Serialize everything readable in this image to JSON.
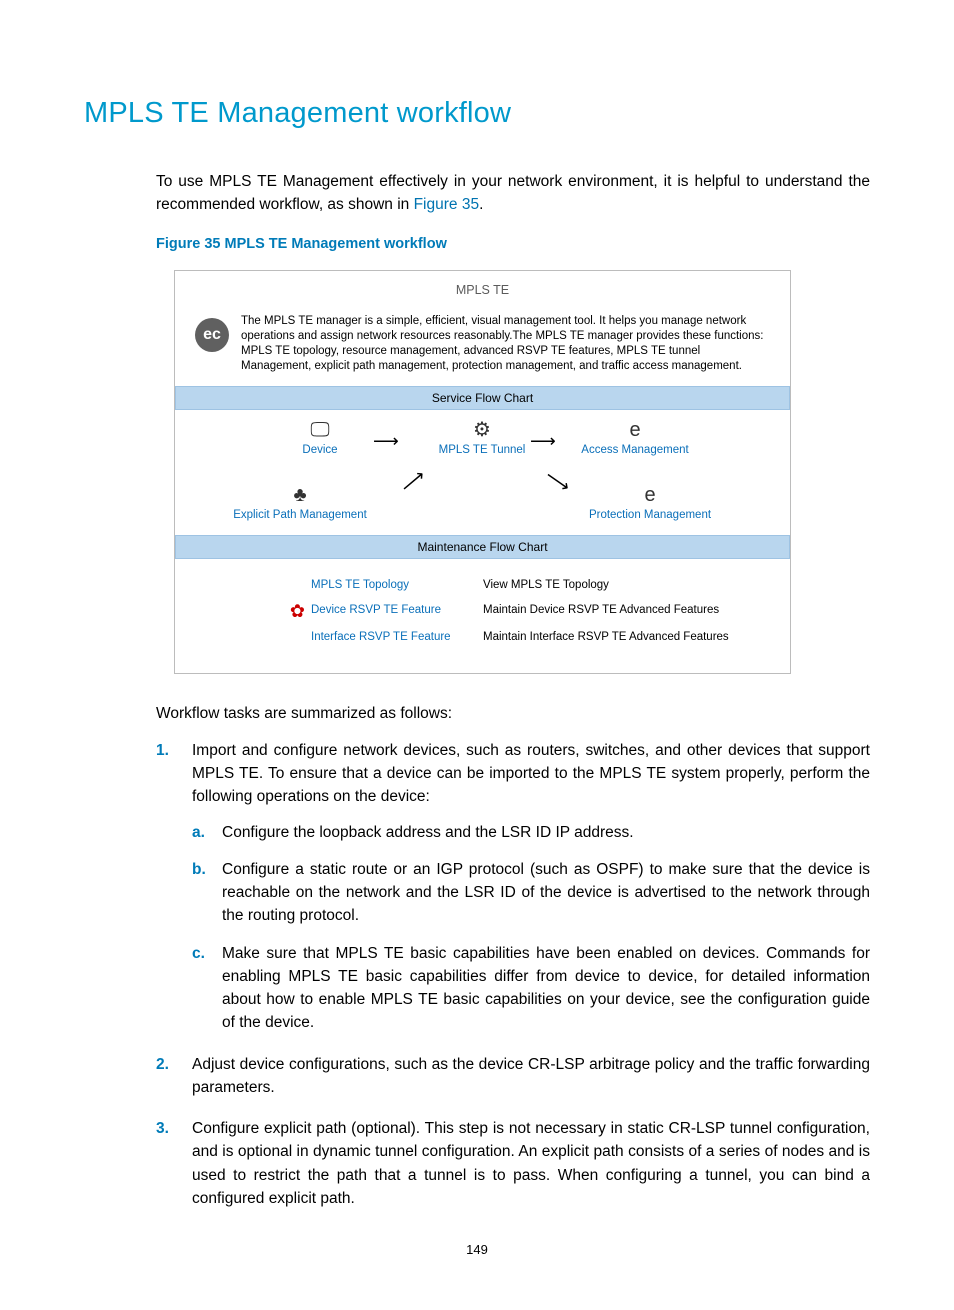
{
  "heading": "MPLS TE Management workflow",
  "intro_before_link": "To use MPLS TE Management effectively in your network environment, it is helpful to understand the recommended workflow, as shown in ",
  "intro_link": "Figure 35",
  "intro_after_link": ".",
  "figure_caption": "Figure 35 MPLS TE Management workflow",
  "figure": {
    "title": "MPLS TE",
    "ec_glyph": "ec",
    "description": "The MPLS TE manager is a simple, efficient, visual management tool. It helps you manage network operations and assign network resources reasonably.The MPLS TE manager provides these functions: MPLS TE topology, resource management, advanced RSVP TE features, MPLS TE tunnel Management, explicit path management, protection management, and traffic access management.",
    "service_bar": "Service Flow Chart",
    "nodes": {
      "device": "Device",
      "tunnel": "MPLS TE Tunnel",
      "access": "Access Management",
      "explicit": "Explicit Path Management",
      "protection": "Protection Management"
    },
    "maint_bar": "Maintenance Flow Chart",
    "maint_rows": [
      {
        "label": "MPLS TE Topology",
        "desc": "View MPLS TE Topology"
      },
      {
        "label": "Device RSVP TE Feature",
        "desc": "Maintain Device RSVP TE Advanced Features"
      },
      {
        "label": "Interface RSVP TE Feature",
        "desc": "Maintain Interface RSVP TE Advanced Features"
      }
    ],
    "icons": {
      "device_glyph": "🖵",
      "tunnel_glyph": "⚙",
      "access_glyph": "e",
      "explicit_glyph": "♣",
      "protection_glyph": "e",
      "gear_glyph": "✿"
    }
  },
  "after_figure": "Workflow tasks are summarized as follows:",
  "steps": [
    {
      "text": "Import and configure network devices, such as routers, switches, and other devices that support MPLS TE. To ensure that a device can be imported to the MPLS TE system properly, perform the following operations on the device:",
      "sub": [
        "Configure the loopback address and the LSR ID IP address.",
        "Configure a static route or an IGP protocol (such as OSPF) to make sure that the device is reachable on the network and the LSR ID of the device is advertised to the network through the routing protocol.",
        "Make sure that MPLS TE basic capabilities have been enabled on devices. Commands for enabling MPLS TE basic capabilities differ from device to device, for detailed information about how to enable MPLS TE basic capabilities on your device, see the configuration guide of the device."
      ]
    },
    {
      "text": "Adjust device configurations, such as the device CR-LSP arbitrage policy and the traffic forwarding parameters."
    },
    {
      "text": "Configure explicit path (optional). This step is not necessary in static CR-LSP tunnel configuration, and is optional in dynamic tunnel configuration. An explicit path consists of a series of nodes and is used to restrict the path that a tunnel is to pass. When configuring a tunnel, you can bind a configured explicit path."
    }
  ],
  "page_number": "149"
}
